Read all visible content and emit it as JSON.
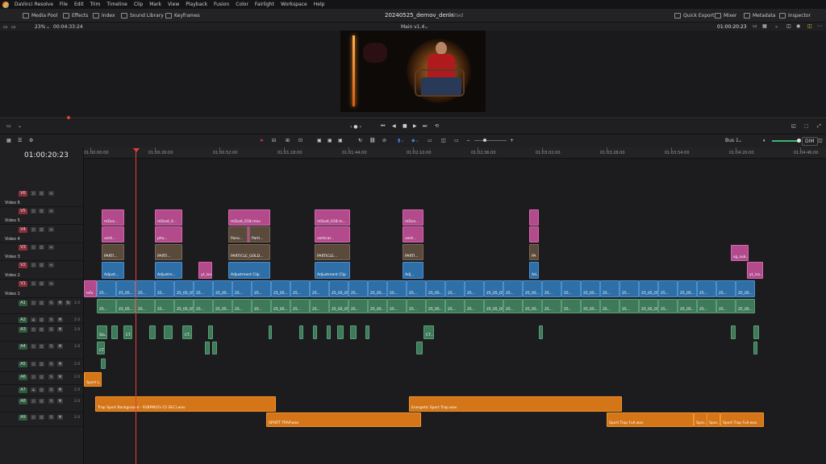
{
  "app": {
    "logo_label": "DaVinci Resolve",
    "menus": [
      "DaVinci Resolve",
      "File",
      "Edit",
      "Trim",
      "Timeline",
      "Clip",
      "Mark",
      "View",
      "Playback",
      "Fusion",
      "Color",
      "Fairlight",
      "Workspace",
      "Help"
    ]
  },
  "toolbar": {
    "media_pool": "Media Pool",
    "effects": "Effects",
    "index": "Index",
    "sound_library": "Sound Library",
    "keyframes": "Keyframes",
    "project_title": "20240525_dernov_denis",
    "edited": "Edited",
    "quick_export": "Quick Export",
    "mixer": "Mixer",
    "metadata": "Metadata",
    "inspector": "Inspector"
  },
  "viewer": {
    "zoom": "23%",
    "source_timecode": "00:04:33:24",
    "timeline_name": "Main v1.4",
    "record_timecode": "01:00:20:23"
  },
  "timeline": {
    "current_timecode": "01:00:20:23",
    "bus": "Bus 1",
    "dim": "DIM",
    "ruler": [
      "01:00:00:00",
      "01:00:26:00",
      "01:00:52:00",
      "01:01:18:00",
      "01:01:44:00",
      "01:02:10:00",
      "01:02:36:00",
      "01:03:02:00",
      "01:03:28:00",
      "01:03:54:00",
      "01:04:20:00",
      "01:04:46:00"
    ],
    "video_tracks": [
      {
        "id": "V6",
        "name": "Video 6"
      },
      {
        "id": "V5",
        "name": "Video 5"
      },
      {
        "id": "V4",
        "name": "Video 4"
      },
      {
        "id": "V3",
        "name": "Video 3"
      },
      {
        "id": "V2",
        "name": "Video 2"
      },
      {
        "id": "V1",
        "name": "Video 1"
      }
    ],
    "audio_tracks": [
      {
        "id": "A1",
        "level": "2.0"
      },
      {
        "id": "A2",
        "level": "2.0"
      },
      {
        "id": "A3",
        "level": "2.0"
      },
      {
        "id": "A4",
        "level": "2.0"
      },
      {
        "id": "A5",
        "level": "2.0"
      },
      {
        "id": "A6",
        "level": "2.0"
      },
      {
        "id": "A7",
        "level": "2.0"
      },
      {
        "id": "A8",
        "level": "2.0"
      },
      {
        "id": "A9",
        "level": "2.0"
      }
    ],
    "track_buttons": {
      "solo": "S",
      "mute": "M",
      "fx": "fx"
    },
    "clip_labels": {
      "mdust_short": "mDus...",
      "mdust_0": "mDust_0...",
      "mdust_018": "mDust_018.mov",
      "mdust_018b": "mDust_018.m...",
      "mdust_01": "mDus...",
      "vertical": "verti...",
      "pho": "pho...",
      "vertical2": "vertical...",
      "verti2": "verti...",
      "parti": "PARTI...",
      "parti2": "PARTI...",
      "particle_gold": "PARTICLE_GOLD...",
      "particle": "PARTICLE...",
      "parti3": "PARTI...",
      "pa": "PA",
      "pano": "Pano...",
      "part": "Parti...",
      "adjust": "Adjust...",
      "adjustm": "Adjustm...",
      "adjustment_clip": "Adjustment Clip",
      "adjustment_clip2": "Adjustment Clip",
      "adj": "Adj...",
      "ad": "Ad...",
      "yt_iso": "yt_iso...",
      "sg_sub": "sg_sub...",
      "yt_ins": "yt_ins...",
      "info": "Info",
      "sla": "Sla...",
      "ct": "CT...",
      "ct2": "CT...",
      "ct3": "CT...",
      "ct4": "CT...",
      "sport_l": "Sport L...",
      "a8_main": "Trap Sport Background - 91BPM(01-15 SEC).wav",
      "a8_energetic": "Energetic Sport Trap.wav",
      "a9_sport": "SPORT TRAP.wav",
      "a9_full1": "Sport Trap Full.wav",
      "a9_spo1": "Spor...",
      "a9_spo2": "Spor...",
      "a9_full2": "Sport Trap Full.wav",
      "v1_25": "25...",
      "v1_25_05": "25_05...",
      "v1_25_05b": "25_05_05..."
    }
  }
}
